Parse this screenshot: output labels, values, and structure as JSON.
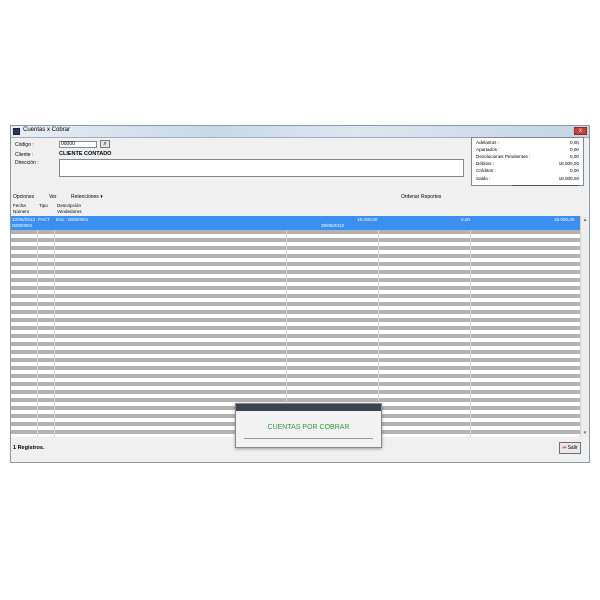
{
  "window": {
    "title": "Cuentas x Cobrar",
    "close": "x"
  },
  "form": {
    "codigo_label": "Código :",
    "codigo_value": "00000",
    "cliente_label": "Cliente :",
    "cliente_name": "CLIENTE CONTADO",
    "direccion_label": "Dirección :"
  },
  "summary": {
    "rows": [
      {
        "label": "Adelantos :",
        "value": "0,00"
      },
      {
        "label": "Apartados :",
        "value": "0,00"
      },
      {
        "label": "Devoluciones Pendientes :",
        "value": "0,00"
      },
      {
        "label": "Débitos :",
        "value": "18.000,00"
      },
      {
        "label": "Créditos :",
        "value": "0,00"
      },
      {
        "label": "Saldo :",
        "value": "18.000,00"
      }
    ]
  },
  "menu": {
    "opciones": "Opciones",
    "ver": "Ver",
    "retenciones": "Retenciones",
    "ordenar": "Ordenar",
    "reportes": "Reportes"
  },
  "grid": {
    "headers": {
      "fecha": "Fecha",
      "tipo": "Tipo",
      "descripcion": "Descripción",
      "numero": "Número",
      "vendedores": "Vendedores"
    },
    "selected_row": {
      "fecha": "12/06/2013",
      "tipo": "FACT",
      "descripcion": "Doc.: 00000001",
      "numero": "00000001",
      "monto1": "18.000,00",
      "fecha2": "28/06/2013",
      "monto2": "0,00",
      "monto3": "18.000,00"
    }
  },
  "status": {
    "registros": "1 Registros."
  },
  "buttons": {
    "salir": "Salir"
  },
  "toast": {
    "text": "CUENTAS POR COBRAR"
  },
  "colors": {
    "selection": "#3b8ff0",
    "stripe": "#b3b3b3",
    "toast_text": "#2f9a3c",
    "close": "#c8453b"
  }
}
